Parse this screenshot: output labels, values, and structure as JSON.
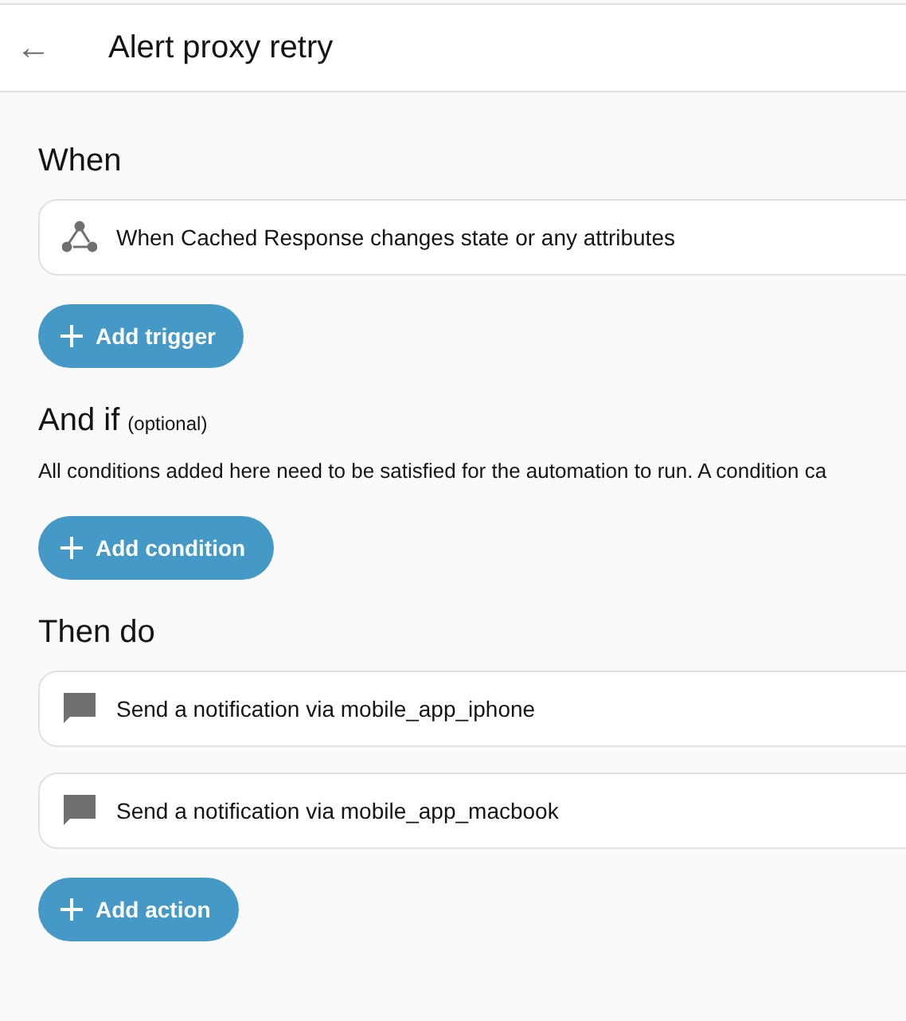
{
  "header": {
    "back_icon": "←",
    "title": "Alert proxy retry"
  },
  "sections": [
    {
      "heading": "When",
      "items": [
        {
          "kind": "trigger",
          "text": "When Cached Response changes state or any attributes"
        }
      ],
      "button": "Add trigger"
    },
    {
      "heading": "And if",
      "note": "(optional)",
      "description": "All conditions added here need to be satisfied for the automation to run. A condition ca",
      "button": "Add condition"
    },
    {
      "heading": "Then do",
      "items": [
        {
          "kind": "notification",
          "text": "Send a notification via mobile_app_iphone"
        },
        {
          "kind": "notification",
          "text": "Send a notification via mobile_app_macbook"
        }
      ],
      "button": "Add action"
    }
  ]
}
